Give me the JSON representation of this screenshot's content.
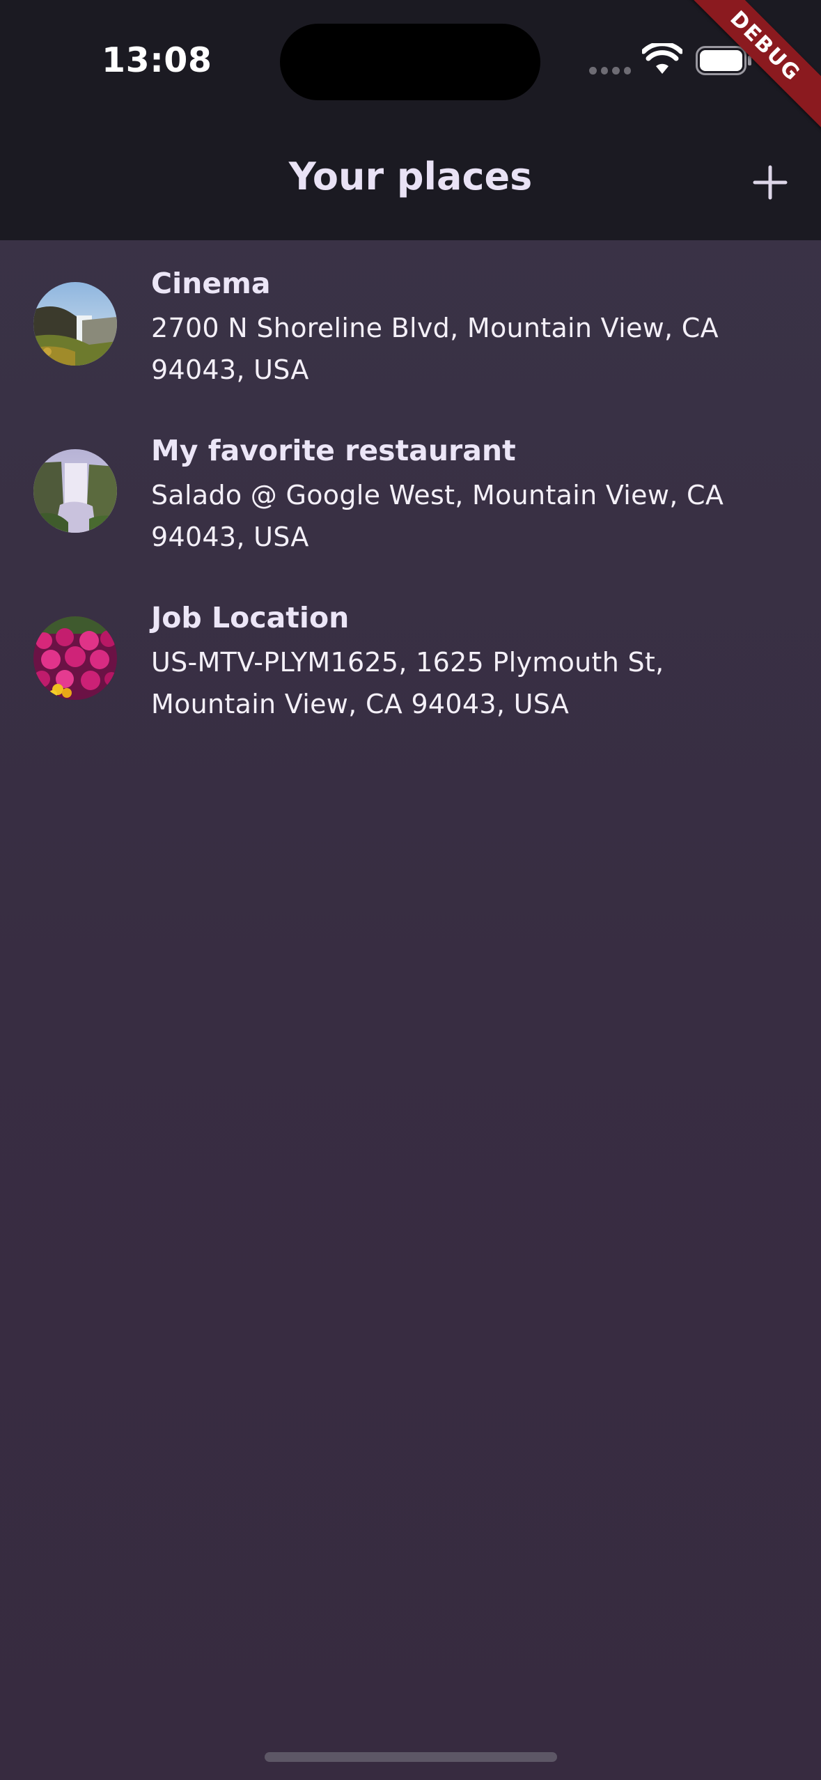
{
  "status_bar": {
    "time": "13:08"
  },
  "debug_banner": {
    "label": "DEBUG"
  },
  "app_bar": {
    "title": "Your places",
    "add_icon": "plus-icon"
  },
  "places": [
    {
      "title": "Cinema",
      "address": "2700 N Shoreline Blvd, Mountain View, CA 94043, USA",
      "thumbnail": "waterfall-cliff"
    },
    {
      "title": "My favorite restaurant",
      "address": "Salado @ Google West, Mountain View, CA 94043, USA",
      "thumbnail": "waterfall-mist"
    },
    {
      "title": "Job Location",
      "address": "US-MTV-PLYM1625, 1625 Plymouth St, Mountain View, CA 94043, USA",
      "thumbnail": "pink-flowers"
    }
  ],
  "colors": {
    "app_bar_bg": "#1b1a22",
    "body_bg": "#382d42",
    "title_text": "#e9e2f5",
    "debug_banner": "#8b1a1f"
  }
}
